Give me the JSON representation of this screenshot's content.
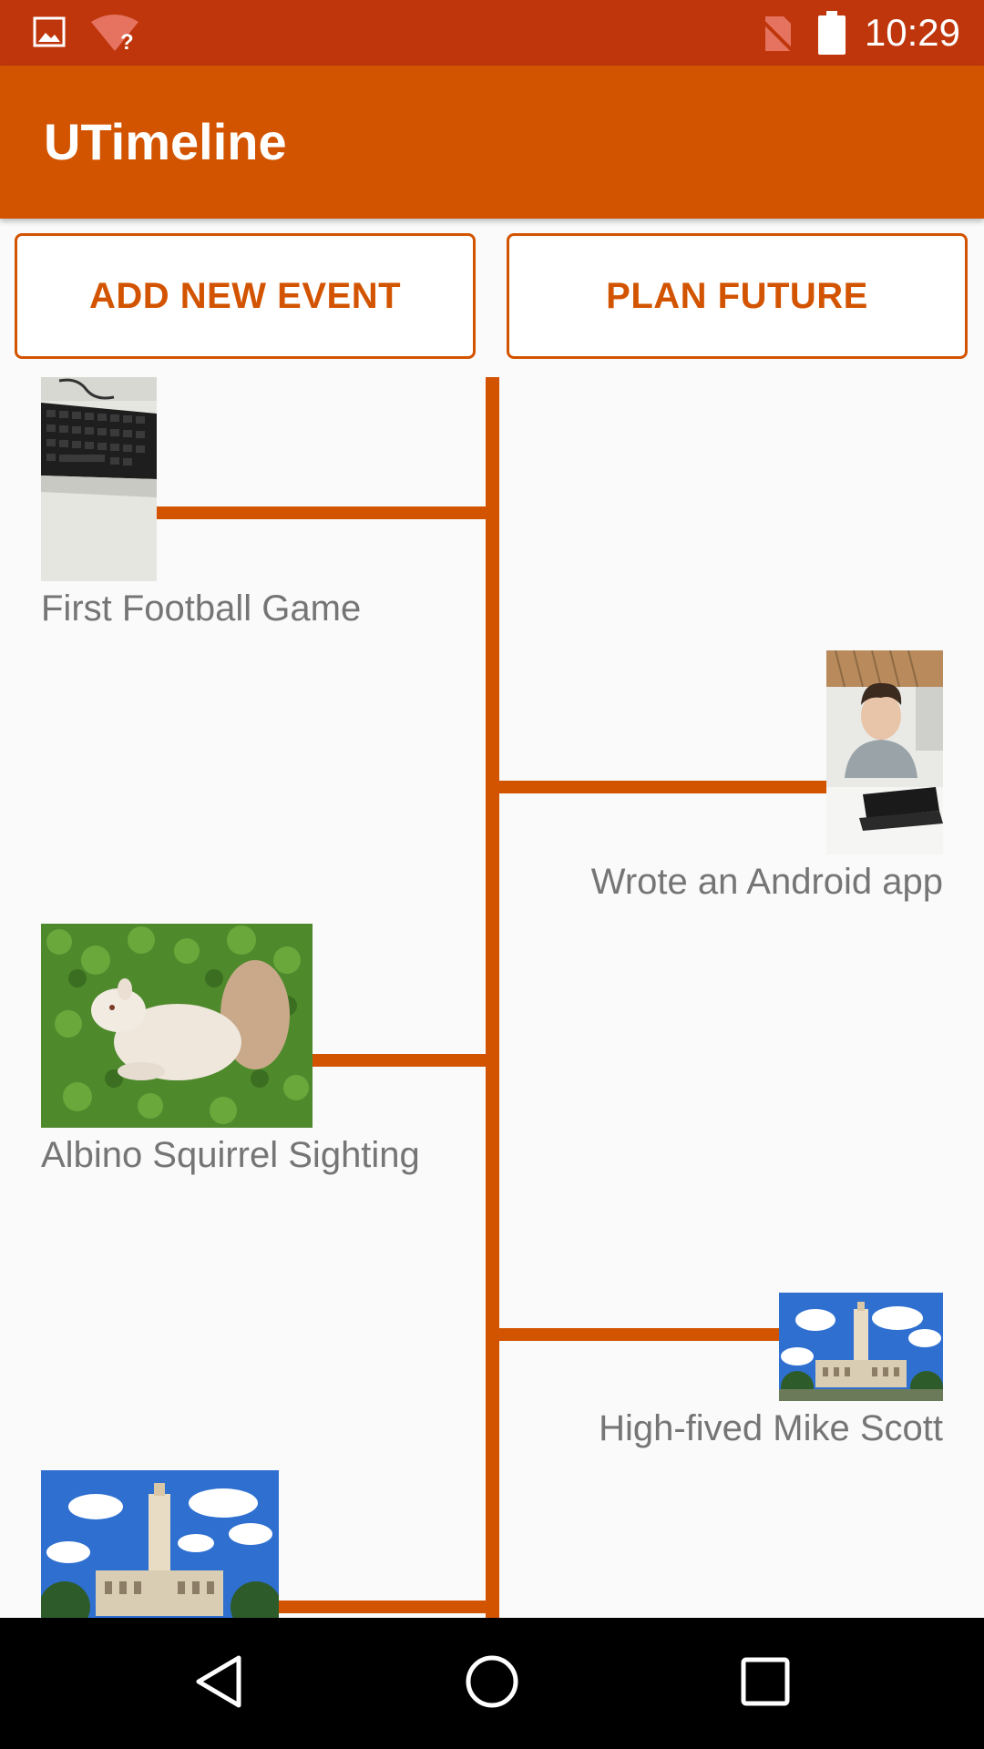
{
  "status_bar": {
    "time": "10:29",
    "icons": [
      "image-notification-icon",
      "wifi-unknown-icon",
      "no-sim-icon",
      "battery-icon"
    ]
  },
  "app_bar": {
    "title": "UTimeline"
  },
  "actions": {
    "add_label": "ADD NEW EVENT",
    "plan_label": "PLAN FUTURE"
  },
  "events": [
    {
      "caption": "First Football Game",
      "side": "left",
      "photo": "keyboard photo"
    },
    {
      "caption": "Wrote an Android app",
      "side": "right",
      "photo": "student at laptop photo"
    },
    {
      "caption": "Albino Squirrel Sighting",
      "side": "left",
      "photo": "white squirrel photo"
    },
    {
      "caption": "High-fived Mike Scott",
      "side": "right",
      "photo": "UT tower photo"
    },
    {
      "caption": "",
      "side": "left",
      "photo": "UT tower photo"
    }
  ],
  "navigation": {
    "back": "back-icon",
    "home": "home-icon",
    "recents": "recents-icon"
  },
  "colors": {
    "accent": "#d35400",
    "status_bar": "#bf360c",
    "caption": "#757575",
    "background": "#fafafa"
  }
}
